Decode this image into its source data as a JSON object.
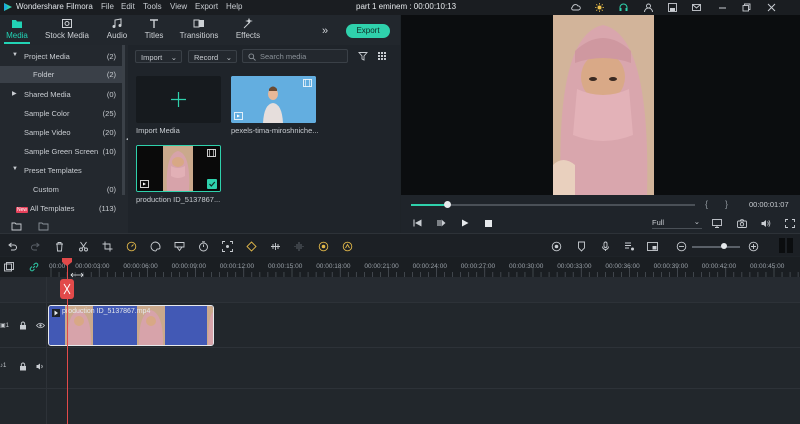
{
  "titlebar": {
    "app_name": "Wondershare Filmora",
    "menu": [
      "File",
      "Edit",
      "Tools",
      "View",
      "Export",
      "Help"
    ],
    "project": "part 1 eminem : 00:00:10:13"
  },
  "tabs": [
    {
      "label": "Media",
      "icon": "folder-icon"
    },
    {
      "label": "Stock Media",
      "icon": "stock-media-icon"
    },
    {
      "label": "Audio",
      "icon": "music-note-icon"
    },
    {
      "label": "Titles",
      "icon": "titles-icon"
    },
    {
      "label": "Transitions",
      "icon": "transitions-icon"
    },
    {
      "label": "Effects",
      "icon": "effects-icon"
    }
  ],
  "export_label": "Export",
  "sidebar": [
    {
      "label": "Project Media",
      "count": "(2)",
      "expanded": true
    },
    {
      "label": "Folder",
      "count": "(2)",
      "selected": true
    },
    {
      "label": "Shared Media",
      "count": "(0)",
      "expandable": true
    },
    {
      "label": "Sample Color",
      "count": "(25)"
    },
    {
      "label": "Sample Video",
      "count": "(20)"
    },
    {
      "label": "Sample Green Screen",
      "count": "(10)"
    },
    {
      "label": "Preset Templates",
      "count": "",
      "expanded": true
    },
    {
      "label": "Custom",
      "count": "(0)"
    },
    {
      "label": "All Templates",
      "count": "(113)",
      "badge": "New"
    }
  ],
  "media_toolbar": {
    "import_label": "Import",
    "record_label": "Record",
    "search_placeholder": "Search media"
  },
  "media_items": [
    {
      "caption": "Import Media"
    },
    {
      "caption": "pexels-tima-miroshniche..."
    },
    {
      "caption": "production ID_5137867..."
    }
  ],
  "preview": {
    "timecode": "00:00:01:07",
    "quality": "Full",
    "progress": 0.13
  },
  "timeline": {
    "ticks": [
      "00:00",
      "00:00:03:00",
      "00:00:06:00",
      "00:00:09:00",
      "00:00:12:00",
      "00:00:15:00",
      "00:00:18:00",
      "00:00:21:00",
      "00:00:24:00",
      "00:00:27:00",
      "00:00:30:00",
      "00:00:33:00",
      "00:00:36:00",
      "00:00:39:00",
      "00:00:42:00",
      "00:00:45:00"
    ],
    "clip_name": "production ID_5137867.mp4",
    "video_track_label": "1",
    "audio_track_label": "1"
  },
  "colors": {
    "accent": "#22d3b5",
    "clip": "#4259b5",
    "playhead": "#e24a4a"
  }
}
